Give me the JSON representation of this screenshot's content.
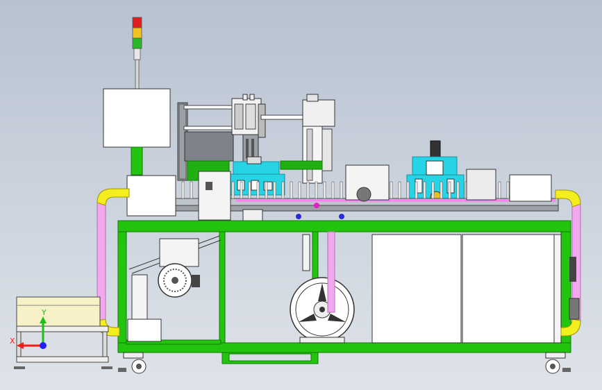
{
  "viewport": {
    "kind": "cad-3d-assembly-view",
    "background_colors": [
      "#b7c2d0",
      "#dfe3e9"
    ],
    "colors": {
      "frame": "#22c40e",
      "frame_edge": "#127a05",
      "air_pipe": "#f2a8ef",
      "pipe_elbow": "#f5ee1e",
      "cyan_block": "#26d4e6",
      "sheet": "#ffffff",
      "bin": "#f6f1c6"
    }
  },
  "triad": {
    "x_label": "X",
    "y_label": "Y",
    "x_color": "#ff1a1a",
    "y_color": "#18c018",
    "z_color": "#2020ff"
  },
  "signal_tower": {
    "lights": [
      "red",
      "yellow",
      "green"
    ],
    "colors": [
      "#e02020",
      "#f2c21e",
      "#2ab82a"
    ]
  }
}
